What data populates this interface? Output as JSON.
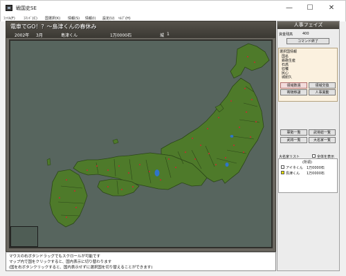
{
  "window": {
    "title": "戦国史SE",
    "minimize": "—",
    "maximize": "☐",
    "close": "✕"
  },
  "menu": [
    "ﾌｧｲﾙ(F)",
    "ｺﾏﾝﾄﾞ(C)",
    "国選択(K)",
    "情報(S)",
    "情報(I)",
    "設定(U)",
    "ﾍﾙﾌﾟ(H)"
  ],
  "header": {
    "title": "電車でGO！？〜島津くんの春休み",
    "year": "2002年",
    "month": "3月",
    "daimyo": "島津くん",
    "koku": "1万0000石",
    "castles_label": "城",
    "castles_value": "1"
  },
  "map": {
    "land_color": "#4e7a2a",
    "sea_color": "#57655e",
    "castle_color": "#b03a2e",
    "lake_color": "#2f74c8"
  },
  "info": [
    "マウスの右ボタンドラッグでもスクロールが可能です",
    "マップ内で国をクリックすると、国内表示に切り替わります",
    "(国を右ボタンクリックすると、国内表示せずに選択国を切り替えることができます)"
  ],
  "panel": {
    "phase": "人事フェイズ",
    "action_points_label": "資金残高",
    "action_points_value": "400",
    "end_command": "コマンド終了",
    "selected_province_label": "選択国情報",
    "selected_province_items": [
      "国名",
      "鉄砲生産",
      "石高",
      "収穫",
      "民心",
      "城耐久"
    ],
    "buttons": {
      "b1": "領域数週",
      "b2": "領域交換",
      "b3": "寄騎移譲",
      "b4": "人事異動"
    },
    "buttons2": {
      "b1": "軍勢一覧",
      "b2": "武将総一覧",
      "b3": "武将一覧",
      "b4": "大名家一覧"
    },
    "daimyo_list_label": "大名家リスト",
    "show_all_label": "全体を表示",
    "list_header": "(所領)",
    "list": [
      {
        "name": "アイネくん",
        "koku": "1万0000石",
        "color": "#ffffff"
      },
      {
        "name": "島津くん",
        "koku": "1万0000石",
        "color": "#e8e000"
      }
    ]
  }
}
